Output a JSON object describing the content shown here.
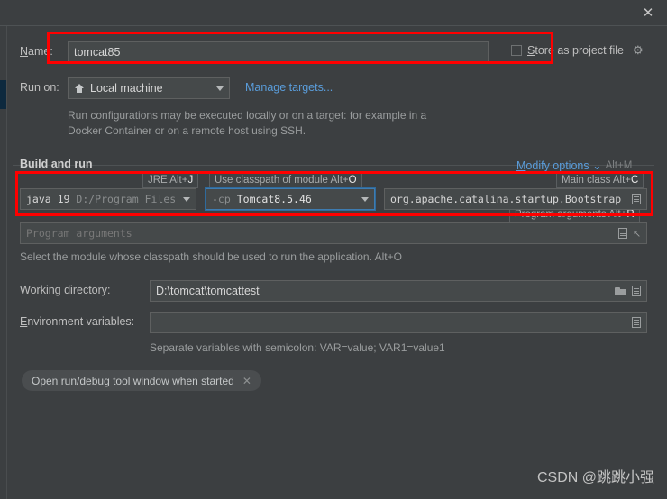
{
  "window": {
    "close_icon": "close-icon"
  },
  "name_row": {
    "label": "Name:",
    "mnemonic": "N",
    "label_rest": "ame:",
    "value": "tomcat85",
    "store_label_mnemonic": "S",
    "store_label_rest": "tore as project file",
    "store_checked": false,
    "gear_icon": "gear-icon"
  },
  "run_on": {
    "label": "Run on:",
    "target": "Local machine",
    "target_icon": "home-icon",
    "manage_link": "Manage targets...",
    "description": "Run configurations may be executed locally or on a target: for example in a Docker Container or on a remote host using SSH."
  },
  "build_and_run": {
    "title": "Build and run",
    "modify_options": "Modify options",
    "modify_mnemonic": "M",
    "modify_options_rest": "odify options",
    "modify_shortcut": "Alt+M",
    "hints": {
      "jre": "JRE Alt+",
      "jre_key": "J",
      "classpath": "Use classpath of module Alt+",
      "classpath_key": "O",
      "main_class": "Main class Alt+",
      "main_class_key": "C",
      "program_arguments": "Program arguments Alt+",
      "program_arguments_key": "R"
    },
    "jre": {
      "name": "java 19",
      "path": "D:/Program Files"
    },
    "classpath": {
      "prefix": "-cp",
      "module": "Tomcat8.5.46"
    },
    "main_class": "org.apache.catalina.startup.Bootstrap",
    "program_arguments_placeholder": "Program arguments",
    "module_hint": "Select the module whose classpath should be used to run the application. Alt+O"
  },
  "working_directory": {
    "label": "Working directory:",
    "mnemonic": "W",
    "label_rest": "orking directory:",
    "value": "D:\\tomcat\\tomcattest",
    "folder_icon": "folder-icon",
    "macro_icon": "macro-list-icon"
  },
  "environment_variables": {
    "label": "Environment variables:",
    "mnemonic": "E",
    "label_rest": "nvironment variables:",
    "value": "",
    "macro_icon": "macro-list-icon",
    "hint": "Separate variables with semicolon: VAR=value; VAR1=value1"
  },
  "tool_window_chip": {
    "label": "Open run/debug tool window when started",
    "close_icon": "close-icon"
  },
  "watermark": "CSDN @跳跳小强",
  "colors": {
    "background": "#3c3f41",
    "field_background": "#45494a",
    "accent_link": "#5a9ddb",
    "focus_border": "#3e7cb1",
    "annotation": "#ff0000"
  }
}
